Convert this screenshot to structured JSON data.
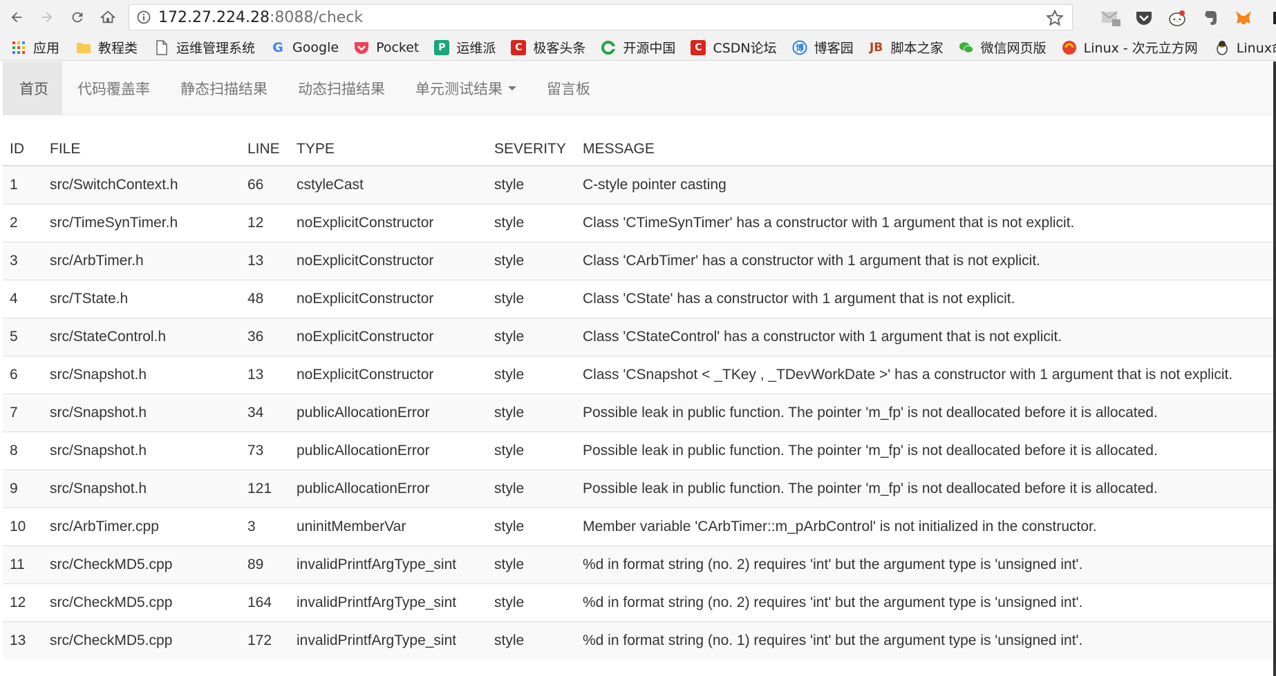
{
  "browser": {
    "url_host": "172.27.224.28",
    "url_rest": ":8088/check"
  },
  "bookmarks": [
    {
      "label": "应用",
      "icon": "apps-grid-icon",
      "color": "#e94335"
    },
    {
      "label": "教程类",
      "icon": "folder-icon",
      "color": "#f7cb4d"
    },
    {
      "label": "运维管理系统",
      "icon": "page-icon",
      "color": "#888888"
    },
    {
      "label": "Google",
      "icon": "google-icon",
      "color": "#4285f4"
    },
    {
      "label": "Pocket",
      "icon": "pocket-icon",
      "color": "#ef4056"
    },
    {
      "label": "运维派",
      "icon": "yunweipai-icon",
      "color": "#1aa57a"
    },
    {
      "label": "极客头条",
      "icon": "csdn-icon",
      "color": "#d9251c"
    },
    {
      "label": "开源中国",
      "icon": "oschina-icon",
      "color": "#2aa146"
    },
    {
      "label": "CSDN论坛",
      "icon": "csdn-icon",
      "color": "#d9251c"
    },
    {
      "label": "博客园",
      "icon": "cnblogs-icon",
      "color": "#2d7bd3"
    },
    {
      "label": "脚本之家",
      "icon": "jb51-icon",
      "color": "#b9411f"
    },
    {
      "label": "微信网页版",
      "icon": "wechat-icon",
      "color": "#3bb334"
    },
    {
      "label": "Linux - 次元立方网",
      "icon": "ciyuan-icon",
      "color": "#e43f2e"
    },
    {
      "label": "Linux命令搜索",
      "icon": "tux-icon",
      "color": "#444444"
    }
  ],
  "navbar": {
    "items": [
      {
        "label": "首页",
        "active": true
      },
      {
        "label": "代码覆盖率",
        "active": false
      },
      {
        "label": "静态扫描结果",
        "active": false
      },
      {
        "label": "动态扫描结果",
        "active": false
      },
      {
        "label": "单元测试结果",
        "active": false,
        "dropdown": true
      },
      {
        "label": "留言板",
        "active": false
      }
    ]
  },
  "table": {
    "headers": [
      "ID",
      "FILE",
      "LINE",
      "TYPE",
      "SEVERITY",
      "MESSAGE"
    ],
    "rows": [
      [
        "1",
        "src/SwitchContext.h",
        "66",
        "cstyleCast",
        "style",
        "C-style pointer casting"
      ],
      [
        "2",
        "src/TimeSynTimer.h",
        "12",
        "noExplicitConstructor",
        "style",
        "Class 'CTimeSynTimer' has a constructor with 1 argument that is not explicit."
      ],
      [
        "3",
        "src/ArbTimer.h",
        "13",
        "noExplicitConstructor",
        "style",
        "Class 'CArbTimer' has a constructor with 1 argument that is not explicit."
      ],
      [
        "4",
        "src/TState.h",
        "48",
        "noExplicitConstructor",
        "style",
        "Class 'CState' has a constructor with 1 argument that is not explicit."
      ],
      [
        "5",
        "src/StateControl.h",
        "36",
        "noExplicitConstructor",
        "style",
        "Class 'CStateControl' has a constructor with 1 argument that is not explicit."
      ],
      [
        "6",
        "src/Snapshot.h",
        "13",
        "noExplicitConstructor",
        "style",
        "Class 'CSnapshot < _TKey , _TDevWorkDate >' has a constructor with 1 argument that is not explicit."
      ],
      [
        "7",
        "src/Snapshot.h",
        "34",
        "publicAllocationError",
        "style",
        "Possible leak in public function. The pointer 'm_fp' is not deallocated before it is allocated."
      ],
      [
        "8",
        "src/Snapshot.h",
        "73",
        "publicAllocationError",
        "style",
        "Possible leak in public function. The pointer 'm_fp' is not deallocated before it is allocated."
      ],
      [
        "9",
        "src/Snapshot.h",
        "121",
        "publicAllocationError",
        "style",
        "Possible leak in public function. The pointer 'm_fp' is not deallocated before it is allocated."
      ],
      [
        "10",
        "src/ArbTimer.cpp",
        "3",
        "uninitMemberVar",
        "style",
        "Member variable 'CArbTimer::m_pArbControl' is not initialized in the constructor."
      ],
      [
        "11",
        "src/CheckMD5.cpp",
        "89",
        "invalidPrintfArgType_sint",
        "style",
        "%d in format string (no. 2) requires 'int' but the argument type is 'unsigned int'."
      ],
      [
        "12",
        "src/CheckMD5.cpp",
        "164",
        "invalidPrintfArgType_sint",
        "style",
        "%d in format string (no. 2) requires 'int' but the argument type is 'unsigned int'."
      ],
      [
        "13",
        "src/CheckMD5.cpp",
        "172",
        "invalidPrintfArgType_sint",
        "style",
        "%d in format string (no. 1) requires 'int' but the argument type is 'unsigned int'."
      ]
    ]
  }
}
